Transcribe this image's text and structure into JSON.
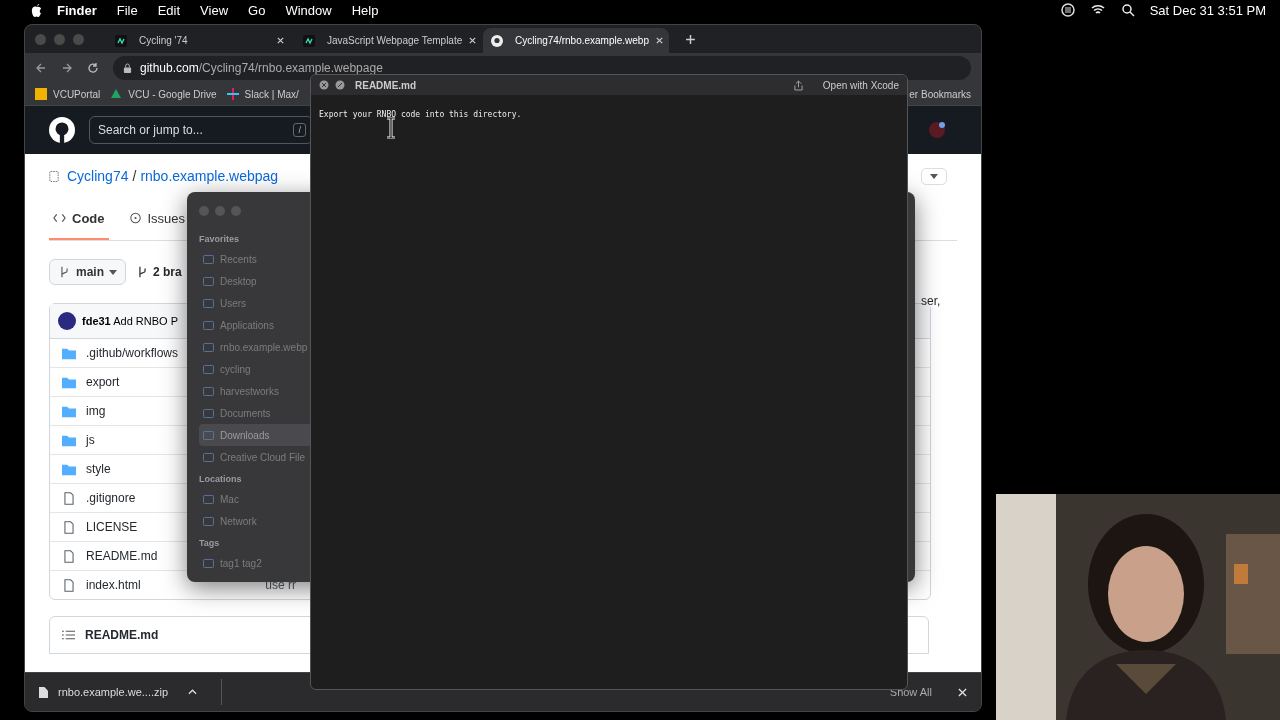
{
  "menu_bar": {
    "app": "Finder",
    "items": [
      "File",
      "Edit",
      "View",
      "Go",
      "Window",
      "Help"
    ],
    "clock": "Sat Dec 31  3:51 PM"
  },
  "browser": {
    "tabs": [
      {
        "title": "Cycling '74",
        "kind": "cycling",
        "selected": false
      },
      {
        "title": "JavaScript Webpage Template",
        "kind": "cycling",
        "selected": false
      },
      {
        "title": "Cycling74/rnbo.example.webp",
        "kind": "github",
        "selected": true
      }
    ],
    "url_host": "github.com",
    "url_path": "/Cycling74/rnbo.example.webpage",
    "bookmarks": [
      {
        "label": "VCUPortal",
        "kind": "vcu"
      },
      {
        "label": "VCU - Google Drive",
        "kind": "drive"
      },
      {
        "label": "Slack | Max/",
        "kind": "slack"
      }
    ],
    "other_bookmarks": "er Bookmarks",
    "download": {
      "file": "rnbo.example.we....zip",
      "show_all": "Show All"
    }
  },
  "github": {
    "search_placeholder": "Search or jump to...",
    "search_key": "/",
    "owner": "Cycling74",
    "path_separator": "/",
    "repo": "rnbo.example.webpag",
    "repo_tabs": [
      {
        "label": "Code",
        "selected": true
      },
      {
        "label": "Issues",
        "selected": false
      }
    ],
    "branch": "main",
    "branches": "2 bra",
    "commit": {
      "hash": "fde31",
      "message": "Add RNBO P"
    },
    "files": [
      {
        "name": ".github/workflows",
        "kind": "folder"
      },
      {
        "name": "export",
        "kind": "folder"
      },
      {
        "name": "img",
        "kind": "folder"
      },
      {
        "name": "js",
        "kind": "folder"
      },
      {
        "name": "style",
        "kind": "folder"
      },
      {
        "name": ".gitignore",
        "kind": "file"
      },
      {
        "name": "LICENSE",
        "kind": "file"
      },
      {
        "name": "README.md",
        "kind": "file"
      },
      {
        "name": "index.html",
        "kind": "file",
        "message": "use rr"
      }
    ],
    "readme_title": "README.md",
    "readme_fragment": "ser,"
  },
  "finder": {
    "sections": [
      {
        "title": "Favorites",
        "items": [
          {
            "label": "Recents",
            "selected": false
          },
          {
            "label": "Desktop",
            "selected": false
          },
          {
            "label": "Users",
            "selected": false
          },
          {
            "label": "Applications",
            "selected": false
          },
          {
            "label": "rnbo.example.webp",
            "selected": false
          },
          {
            "label": "cycling",
            "selected": false
          },
          {
            "label": "harvestworks",
            "selected": false
          },
          {
            "label": "Documents",
            "selected": false
          },
          {
            "label": "Downloads",
            "selected": true
          },
          {
            "label": "Creative Cloud File",
            "selected": false
          }
        ]
      },
      {
        "title": "Locations",
        "items": [
          {
            "label": "Mac",
            "selected": false
          },
          {
            "label": "Network",
            "selected": false
          }
        ]
      },
      {
        "title": "Tags",
        "items": [
          {
            "label": "tag1 tag2",
            "selected": false
          }
        ]
      }
    ]
  },
  "quick_look": {
    "title": "README.md",
    "open_button": "Open with Xcode",
    "content": "Export your RNBO code into this directory."
  }
}
